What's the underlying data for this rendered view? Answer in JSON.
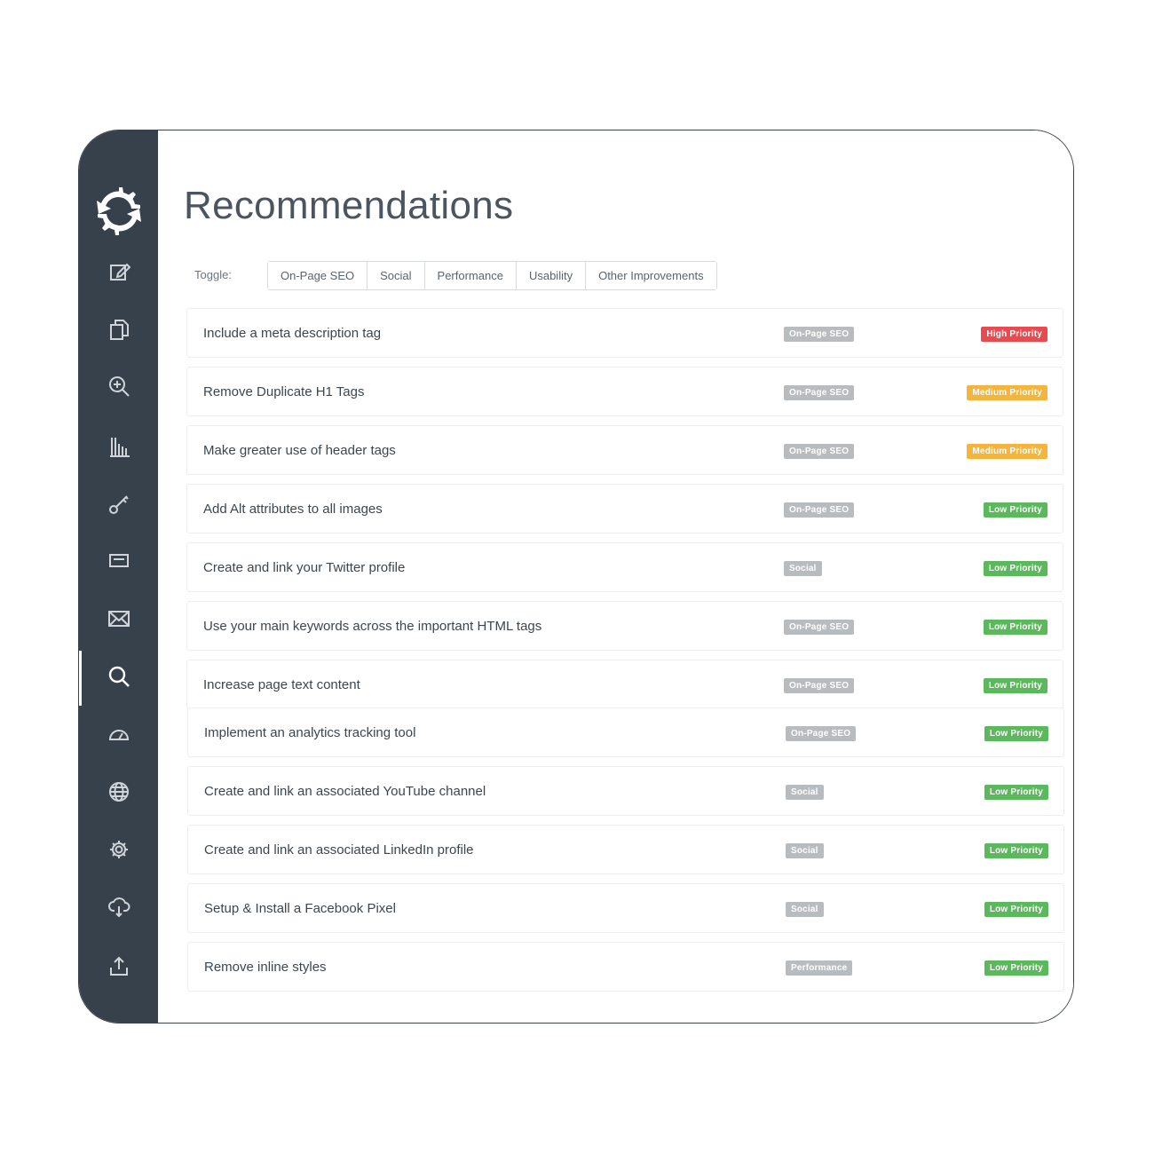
{
  "app": {
    "title": "Recommendations",
    "toggle_label": "Toggle:"
  },
  "toggles": [
    "On-Page SEO",
    "Social",
    "Performance",
    "Usability",
    "Other Improvements"
  ],
  "colors": {
    "sidebar": "#37414b",
    "high": "#e84a4f",
    "medium": "#f5b43c",
    "low": "#5cb85c",
    "category": "#b9bcbf"
  },
  "sidebar_icons": [
    "edit-icon",
    "pages-icon",
    "zoom-in-icon",
    "bar-chart-icon",
    "key-icon",
    "card-icon",
    "mail-icon",
    "search-icon",
    "speedometer-icon",
    "globe-icon",
    "gear-icon",
    "cloud-download-icon",
    "upload-icon"
  ],
  "recommendations": [
    {
      "text": "Include a meta description tag",
      "category": "On-Page SEO",
      "priority": "High Priority",
      "level": "high"
    },
    {
      "text": "Remove Duplicate H1 Tags",
      "category": "On-Page SEO",
      "priority": "Medium Priority",
      "level": "medium"
    },
    {
      "text": "Make greater use of header tags",
      "category": "On-Page SEO",
      "priority": "Medium Priority",
      "level": "medium"
    },
    {
      "text": "Add Alt attributes to all images",
      "category": "On-Page SEO",
      "priority": "Low Priority",
      "level": "low"
    },
    {
      "text": "Create and link your Twitter profile",
      "category": "Social",
      "priority": "Low Priority",
      "level": "low"
    },
    {
      "text": "Use your main keywords across the important HTML tags",
      "category": "On-Page SEO",
      "priority": "Low Priority",
      "level": "low"
    },
    {
      "text": "Increase page text content",
      "category": "On-Page SEO",
      "priority": "Low Priority",
      "level": "low"
    },
    {
      "text": "Implement an analytics tracking tool",
      "category": "On-Page SEO",
      "priority": "Low Priority",
      "level": "low"
    },
    {
      "text": "Create and link an associated YouTube channel",
      "category": "Social",
      "priority": "Low Priority",
      "level": "low"
    },
    {
      "text": "Create and link an associated LinkedIn profile",
      "category": "Social",
      "priority": "Low Priority",
      "level": "low"
    },
    {
      "text": "Setup & Install a Facebook Pixel",
      "category": "Social",
      "priority": "Low Priority",
      "level": "low"
    },
    {
      "text": "Remove inline styles",
      "category": "Performance",
      "priority": "Low Priority",
      "level": "low"
    }
  ]
}
